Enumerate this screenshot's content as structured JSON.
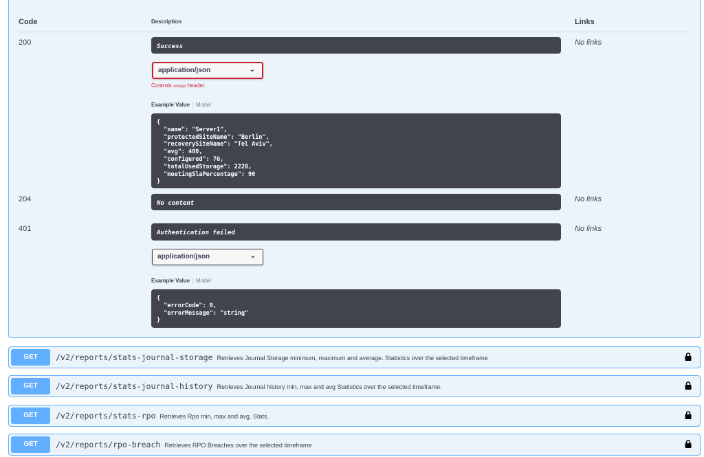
{
  "headers": {
    "code": "Code",
    "description": "Description",
    "links": "Links"
  },
  "responses": [
    {
      "code": "200",
      "description": "Success",
      "links": "No links",
      "media_type": "application/json",
      "controls_pre": "Controls",
      "controls_accept": "Accept",
      "controls_post": "header.",
      "example_tab": "Example Value",
      "model_tab": "Model",
      "example": "{\n  \"name\": \"Server1\",\n  \"protectedSiteName\": \"Berlin\",\n  \"recoverySiteName\": \"Tel Aviv\",\n  \"avg\": 400,\n  \"configured\": 76,\n  \"totalUsedStorage\": 2220,\n  \"meetingSlaPercentage\": 90\n}"
    },
    {
      "code": "204",
      "description": "No content",
      "links": "No links"
    },
    {
      "code": "401",
      "description": "Authentication failed",
      "links": "No links",
      "media_type": "application/json",
      "example_tab": "Example Value",
      "model_tab": "Model",
      "example": "{\n  \"errorCode\": 0,\n  \"errorMessage\": \"string\"\n}"
    }
  ],
  "operations": [
    {
      "method": "GET",
      "path": "/v2/reports/stats-journal-storage",
      "summary": "Retrieves Journal Storage minimum, maximum and average. Statistics over the selected timeframe"
    },
    {
      "method": "GET",
      "path": "/v2/reports/stats-journal-history",
      "summary": "Retrieves Journal history min, max and avg Statistics over the selected timeframe."
    },
    {
      "method": "GET",
      "path": "/v2/reports/stats-rpo",
      "summary": "Retrieves Rpo min, max and avg. Stats."
    },
    {
      "method": "GET",
      "path": "/v2/reports/rpo-breach",
      "summary": "Retrieves RPO Breaches over the selected timeframe"
    }
  ],
  "colors": {
    "get": "#61affe",
    "dark": "#41444e",
    "error": "#d01d2a"
  }
}
